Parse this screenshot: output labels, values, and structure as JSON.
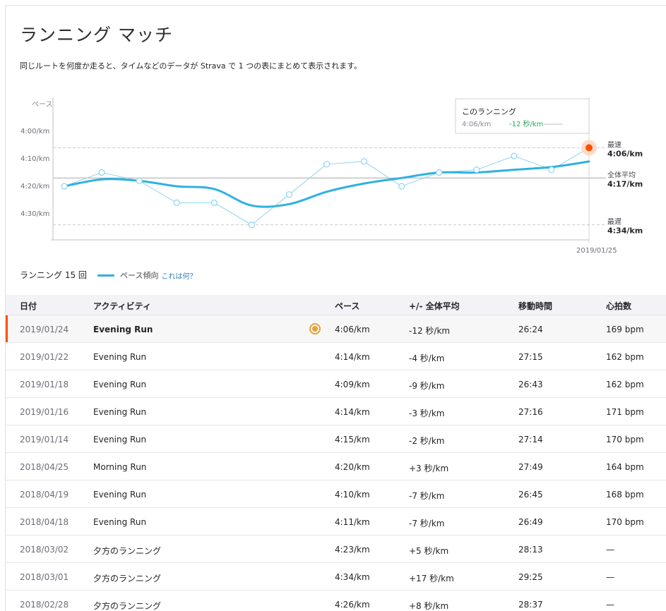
{
  "header": {
    "title": "ランニング マッチ",
    "description": "同じルートを何度か走ると、タイムなどのデータが Strava で 1 つの表にまとめて表示されます。"
  },
  "chart_data": {
    "type": "line",
    "ylabel": "ペース",
    "y_ticks": [
      "4:00/km",
      "4:10/km",
      "4:20/km",
      "4:30/km"
    ],
    "y_tick_values_sec": [
      240,
      250,
      260,
      270
    ],
    "ylim_sec": [
      236,
      278
    ],
    "x_end_label": "2019/01/25",
    "series": [
      {
        "name": "",
        "pace_sec": [
          260,
          255,
          258,
          266,
          266,
          274,
          263,
          252,
          251,
          260,
          255,
          254,
          249,
          254,
          246
        ],
        "pace_trend_sec": [
          260,
          257.5,
          258,
          260,
          261,
          267,
          266.5,
          262,
          259,
          257,
          255,
          255,
          254,
          253,
          251
        ]
      }
    ],
    "reference_lines": [
      {
        "label": "最速",
        "value_label": "4:06/km",
        "pace_sec": 246
      },
      {
        "label": "全体平均",
        "value_label": "4:17/km",
        "pace_sec": 257
      },
      {
        "label": "最遅",
        "value_label": "4:34/km",
        "pace_sec": 274
      }
    ],
    "tooltip": {
      "title": "このランニング",
      "pace": "4:06/km",
      "diff": "-12 秒/km"
    },
    "colors": {
      "trend": "#2eb1e3",
      "points": "#8fd3ef",
      "highlight": "#fc5200",
      "diff_good": "#26a65b"
    }
  },
  "summary": {
    "label": "ランニング 15 回",
    "legend_label": "ペース傾向",
    "legend_link": "これは何？"
  },
  "table": {
    "headers": {
      "date": "日付",
      "activity": "アクティビティ",
      "pace": "ペース",
      "diff": "+/- 全体平均",
      "time": "移動時間",
      "hr": "心拍数"
    },
    "rows": [
      {
        "date": "2019/01/24",
        "activity": "Evening Run",
        "pace": "4:06/km",
        "diff": "-12 秒/km",
        "time": "26:24",
        "hr": "169 bpm"
      },
      {
        "date": "2019/01/22",
        "activity": "Evening Run",
        "pace": "4:14/km",
        "diff": "-4 秒/km",
        "time": "27:15",
        "hr": "162 bpm"
      },
      {
        "date": "2019/01/18",
        "activity": "Evening Run",
        "pace": "4:09/km",
        "diff": "-9 秒/km",
        "time": "26:43",
        "hr": "162 bpm"
      },
      {
        "date": "2019/01/16",
        "activity": "Evening Run",
        "pace": "4:14/km",
        "diff": "-3 秒/km",
        "time": "27:16",
        "hr": "171 bpm"
      },
      {
        "date": "2019/01/14",
        "activity": "Evening Run",
        "pace": "4:15/km",
        "diff": "-2 秒/km",
        "time": "27:14",
        "hr": "170 bpm"
      },
      {
        "date": "2018/04/25",
        "activity": "Morning Run",
        "pace": "4:20/km",
        "diff": "+3 秒/km",
        "time": "27:49",
        "hr": "164 bpm"
      },
      {
        "date": "2018/04/19",
        "activity": "Evening Run",
        "pace": "4:10/km",
        "diff": "-7 秒/km",
        "time": "26:45",
        "hr": "168 bpm"
      },
      {
        "date": "2018/04/18",
        "activity": "Evening Run",
        "pace": "4:11/km",
        "diff": "-7 秒/km",
        "time": "26:49",
        "hr": "170 bpm"
      },
      {
        "date": "2018/03/02",
        "activity": "夕方のランニング",
        "pace": "4:23/km",
        "diff": "+5 秒/km",
        "time": "28:13",
        "hr": "—"
      },
      {
        "date": "2018/03/01",
        "activity": "夕方のランニング",
        "pace": "4:34/km",
        "diff": "+17 秒/km",
        "time": "29:25",
        "hr": "—"
      },
      {
        "date": "2018/02/28",
        "activity": "夕方のランニング",
        "pace": "4:26/km",
        "diff": "+8 秒/km",
        "time": "28:37",
        "hr": "—"
      }
    ]
  }
}
